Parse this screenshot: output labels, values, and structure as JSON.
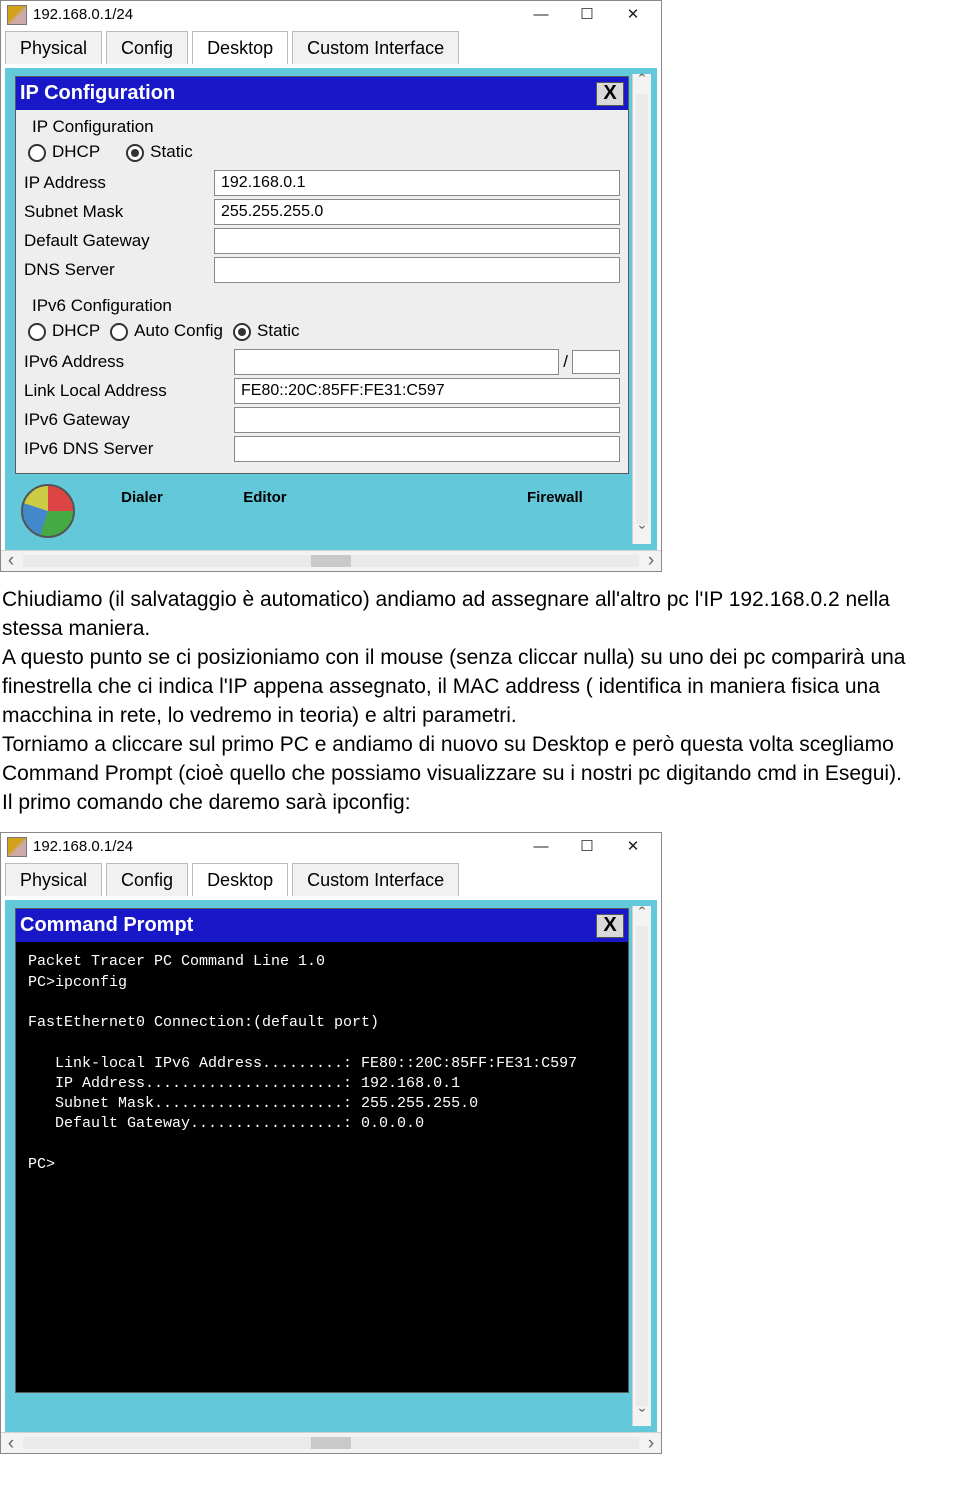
{
  "window1": {
    "title": "192.168.0.1/24",
    "btn_min": "—",
    "btn_max": "☐",
    "btn_close": "✕",
    "tabs": [
      "Physical",
      "Config",
      "Desktop",
      "Custom Interface"
    ],
    "active_tab": 2,
    "dialog": {
      "title": "IP Configuration",
      "close_x": "X",
      "section1": "IP Configuration",
      "radio_dhcp": "DHCP",
      "radio_static": "Static",
      "selected1": "static",
      "ip_address_lbl": "IP Address",
      "ip_address_val": "192.168.0.1",
      "subnet_lbl": "Subnet Mask",
      "subnet_val": "255.255.255.0",
      "gateway_lbl": "Default Gateway",
      "gateway_val": "",
      "dns_lbl": "DNS Server",
      "dns_val": "",
      "section2": "IPv6 Configuration",
      "v6_radio_dhcp": "DHCP",
      "v6_radio_auto": "Auto Config",
      "v6_radio_static": "Static",
      "v6_selected": "static",
      "v6_addr_lbl": "IPv6 Address",
      "v6_addr_val": "",
      "v6_link_lbl": "Link Local Address",
      "v6_link_val": "FE80::20C:85FF:FE31:C597",
      "v6_gw_lbl": "IPv6 Gateway",
      "v6_gw_val": "",
      "v6_dns_lbl": "IPv6 DNS Server",
      "v6_dns_val": ""
    },
    "below_labels": [
      "Dialer",
      "Editor",
      "Firewall"
    ]
  },
  "article": {
    "p1": "Chiudiamo (il salvataggio è automatico)  andiamo ad assegnare all'altro pc l'IP 192.168.0.2 nella stessa maniera.",
    "p2": "A questo punto se ci posizioniamo con il mouse (senza cliccar nulla)  su uno dei pc comparirà una finestrella che ci indica l'IP appena assegnato, il MAC address ( identifica in maniera fisica una macchina in rete, lo vedremo in teoria) e altri parametri.",
    "p3": "Torniamo a cliccare sul primo PC e andiamo di nuovo su Desktop e però questa volta scegliamo Command Prompt (cioè quello che possiamo visualizzare su i nostri pc digitando cmd in Esegui).",
    "p4": "Il primo comando che daremo sarà ipconfig:"
  },
  "window2": {
    "title": "192.168.0.1/24",
    "btn_min": "—",
    "btn_max": "☐",
    "btn_close": "✕",
    "tabs": [
      "Physical",
      "Config",
      "Desktop",
      "Custom Interface"
    ],
    "active_tab": 2,
    "dialog": {
      "title": "Command Prompt",
      "close_x": "X",
      "lines": [
        "Packet Tracer PC Command Line 1.0",
        "PC>ipconfig",
        "",
        "FastEthernet0 Connection:(default port)",
        "",
        "   Link-local IPv6 Address.........: FE80::20C:85FF:FE31:C597",
        "   IP Address......................: 192.168.0.1",
        "   Subnet Mask.....................: 255.255.255.0",
        "   Default Gateway.................: 0.0.0.0",
        "",
        "PC>"
      ]
    }
  }
}
